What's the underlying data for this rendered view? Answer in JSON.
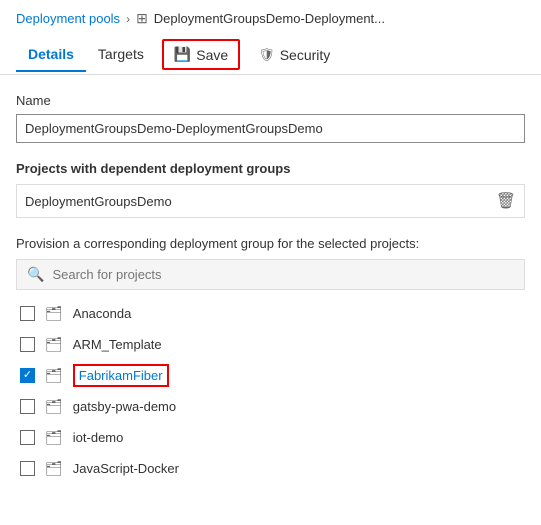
{
  "breadcrumb": {
    "link_label": "Deployment pools",
    "separator": "›",
    "icon": "⊞",
    "current": "DeploymentGroupsDemo-Deployment..."
  },
  "tabs": [
    {
      "id": "details",
      "label": "Details",
      "active": true
    },
    {
      "id": "targets",
      "label": "Targets",
      "active": false
    }
  ],
  "save_button": {
    "label": "Save",
    "icon": "💾"
  },
  "security_tab": {
    "label": "Security",
    "icon": "🛡"
  },
  "form": {
    "name_label": "Name",
    "name_value": "DeploymentGroupsDemo-DeploymentGroupsDemo",
    "projects_section_title": "Projects with dependent deployment groups",
    "existing_project": "DeploymentGroupsDemo",
    "provision_label": "Provision a corresponding deployment group for the selected projects:",
    "search_placeholder": "Search for projects"
  },
  "projects": [
    {
      "id": "anaconda",
      "name": "Anaconda",
      "checked": false,
      "highlighted": false
    },
    {
      "id": "arm_template",
      "name": "ARM_Template",
      "checked": false,
      "highlighted": false
    },
    {
      "id": "fabrikamfiber",
      "name": "FabrikamFiber",
      "checked": true,
      "highlighted": true
    },
    {
      "id": "gatsby",
      "name": "gatsby-pwa-demo",
      "checked": false,
      "highlighted": false
    },
    {
      "id": "iot",
      "name": "iot-demo",
      "checked": false,
      "highlighted": false
    },
    {
      "id": "jsdocker",
      "name": "JavaScript-Docker",
      "checked": false,
      "highlighted": false
    }
  ]
}
